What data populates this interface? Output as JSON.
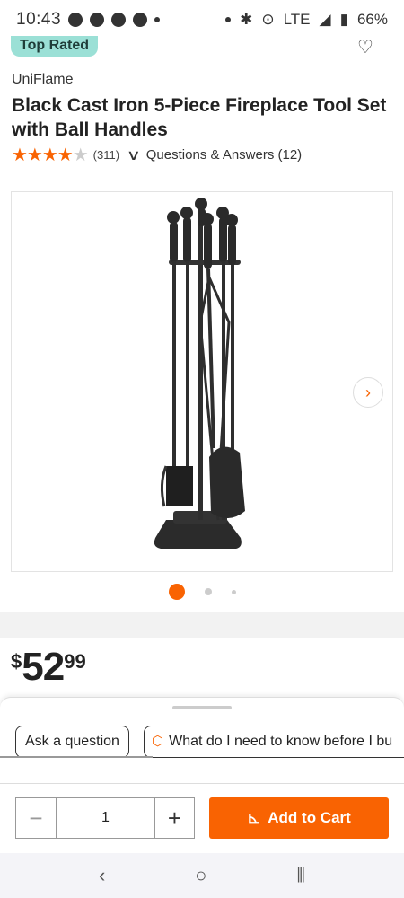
{
  "status_bar": {
    "time": "10:43",
    "network": "LTE",
    "battery": "66%"
  },
  "badge": "Top Rated",
  "product": {
    "brand": "UniFlame",
    "title": "Black Cast Iron 5-Piece Fireplace Tool Set with Ball Handles",
    "rating_stars": 4.5,
    "review_count": "(311)",
    "qa_label": "Questions & Answers (12)",
    "image_alt": "Black cast iron fireplace tool set",
    "carousel_pages": 3,
    "carousel_active": 1
  },
  "price": {
    "dollar": "$",
    "whole": "52",
    "cents": "99"
  },
  "sheet": {
    "chips": [
      {
        "label": "Ask a question"
      },
      {
        "label": "What do I need to know before I bu"
      }
    ]
  },
  "cart": {
    "quantity": "1",
    "add_label": "Add to Cart"
  },
  "colors": {
    "accent": "#f96302",
    "badge_bg": "#9be0d6"
  }
}
